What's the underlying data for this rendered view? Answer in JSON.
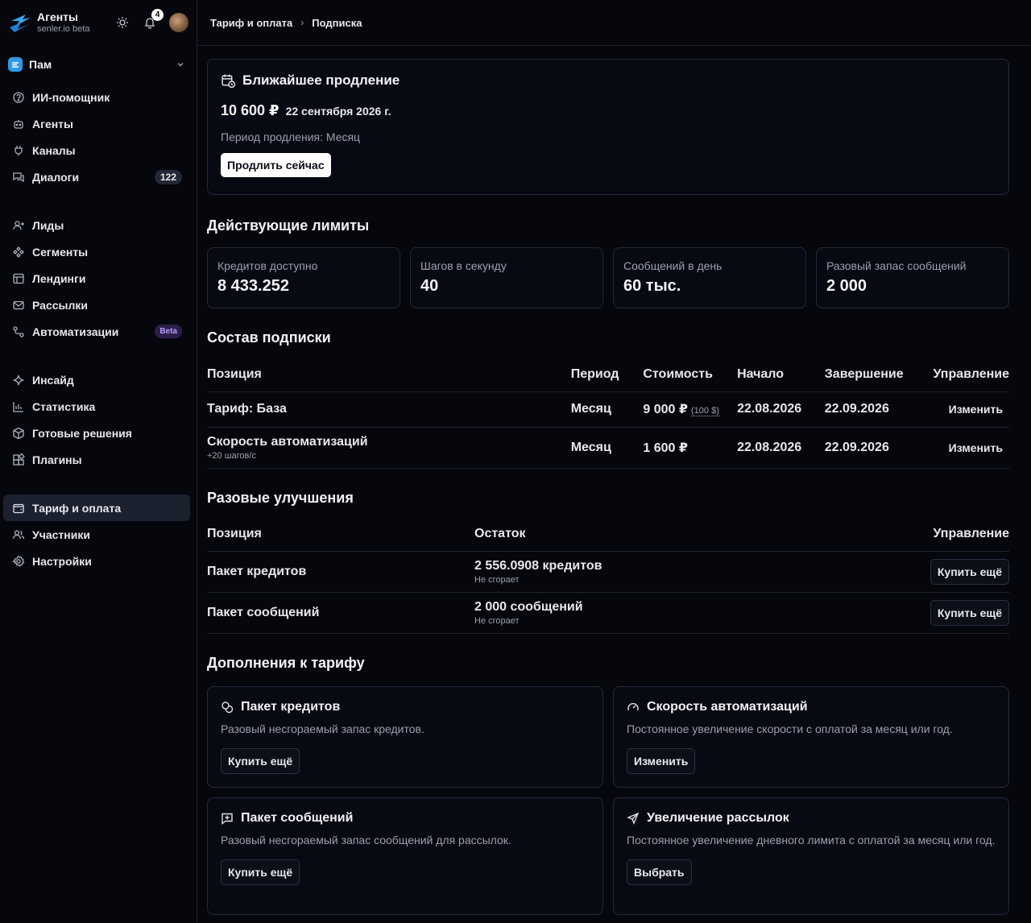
{
  "brand": {
    "name": "Агенты",
    "subtitle": "senler.io beta",
    "notifications": "4"
  },
  "workspace": {
    "name": "Пам"
  },
  "nav": {
    "group1": [
      {
        "label": "ИИ-помощник",
        "icon": "help-circle-icon"
      },
      {
        "label": "Агенты",
        "icon": "bot-icon"
      },
      {
        "label": "Каналы",
        "icon": "plug-icon"
      },
      {
        "label": "Диалоги",
        "icon": "chat-icon",
        "count": "122"
      }
    ],
    "group2": [
      {
        "label": "Лиды",
        "icon": "user-icon"
      },
      {
        "label": "Сегменты",
        "icon": "segments-icon"
      },
      {
        "label": "Лендинги",
        "icon": "layout-icon"
      },
      {
        "label": "Рассылки",
        "icon": "mail-icon"
      },
      {
        "label": "Автоматизации",
        "icon": "flow-icon",
        "badge": "Beta"
      }
    ],
    "group3": [
      {
        "label": "Инсайд",
        "icon": "sparkle-icon"
      },
      {
        "label": "Статистика",
        "icon": "chart-icon"
      },
      {
        "label": "Готовые решения",
        "icon": "box-icon"
      },
      {
        "label": "Плагины",
        "icon": "puzzle-icon"
      }
    ],
    "group4": [
      {
        "label": "Тариф и оплата",
        "icon": "wallet-icon",
        "active": true
      },
      {
        "label": "Участники",
        "icon": "users-icon"
      },
      {
        "label": "Настройки",
        "icon": "gear-icon"
      }
    ]
  },
  "breadcrumb": {
    "parent": "Тариф и оплата",
    "current": "Подписка"
  },
  "renewal": {
    "title": "Ближайшее продление",
    "price": "10 600 ₽",
    "date": "22 сентября 2026 г.",
    "period": "Период продления: Месяц",
    "button": "Продлить сейчас"
  },
  "limits": {
    "title": "Действующие лимиты",
    "items": [
      {
        "label": "Кредитов доступно",
        "value": "8 433.252"
      },
      {
        "label": "Шагов в секунду",
        "value": "40"
      },
      {
        "label": "Сообщений в день",
        "value": "60 тыс."
      },
      {
        "label": "Разовый запас сообщений",
        "value": "2 000"
      }
    ]
  },
  "subscription": {
    "title": "Состав подписки",
    "columns": [
      "Позиция",
      "Период",
      "Стоимость",
      "Начало",
      "Завершение",
      "Управление"
    ],
    "rows": [
      {
        "name": "Тариф: База",
        "sub": "",
        "period": "Месяц",
        "cost": "9 000 ₽",
        "usd": "(100 $)",
        "start": "22.08.2026",
        "end": "22.09.2026",
        "action": "Изменить"
      },
      {
        "name": "Скорость автоматизаций",
        "sub": "+20 шагов/с",
        "period": "Месяц",
        "cost": "1 600 ₽",
        "usd": "",
        "start": "22.08.2026",
        "end": "22.09.2026",
        "action": "Изменить"
      }
    ]
  },
  "upgrades": {
    "title": "Разовые улучшения",
    "columns": [
      "Позиция",
      "Остаток",
      "Управление"
    ],
    "rows": [
      {
        "name": "Пакет кредитов",
        "balance": "2 556.0908 кредитов",
        "note": "Не сгорает",
        "action": "Купить ещё"
      },
      {
        "name": "Пакет сообщений",
        "balance": "2 000 сообщений",
        "note": "Не сгорает",
        "action": "Купить ещё"
      }
    ]
  },
  "addons": {
    "title": "Дополнения к тарифу",
    "items": [
      {
        "title": "Пакет кредитов",
        "desc": "Разовый несгораемый запас кредитов.",
        "button": "Купить ещё",
        "icon": "coins-icon"
      },
      {
        "title": "Скорость автоматизаций",
        "desc": "Постоянное увеличение скорости с оплатой за месяц или год.",
        "button": "Изменить",
        "icon": "gauge-icon"
      },
      {
        "title": "Пакет сообщений",
        "desc": "Разовый несгораемый запас сообщений для рассылок.",
        "button": "Купить ещё",
        "icon": "message-plus-icon"
      },
      {
        "title": "Увеличение рассылок",
        "desc": "Постоянное увеличение дневного лимита с оплатой за месяц или год.",
        "button": "Выбрать",
        "icon": "send-icon"
      }
    ]
  }
}
